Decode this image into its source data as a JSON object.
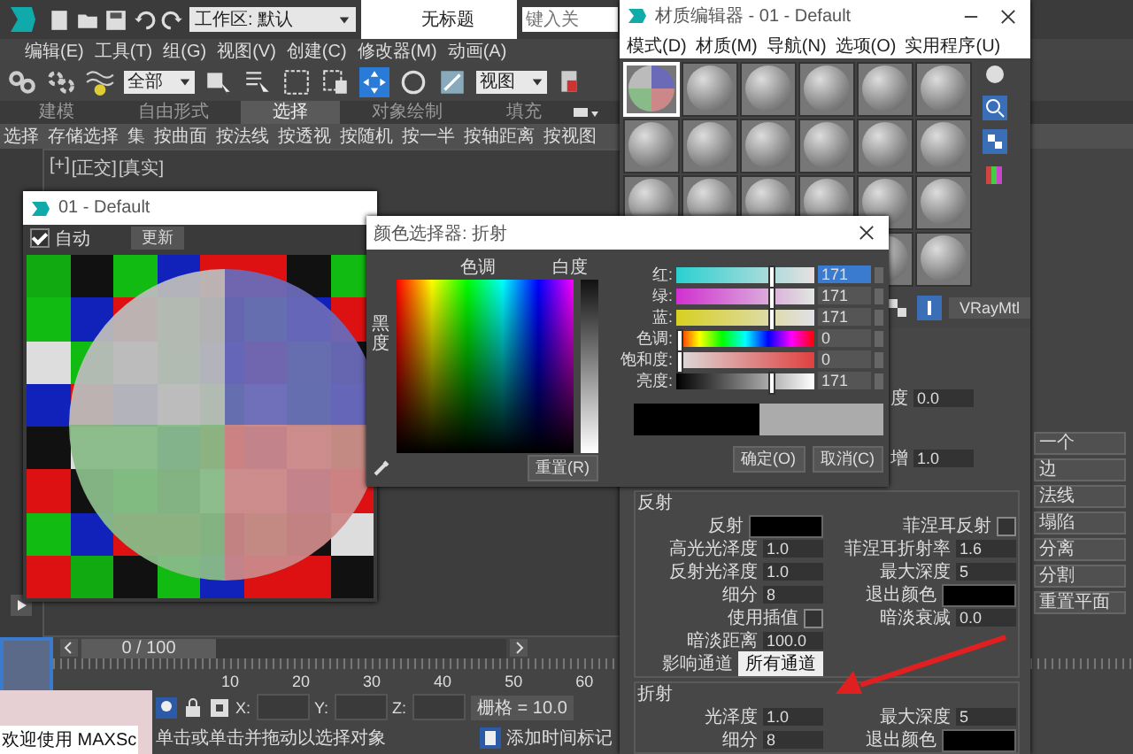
{
  "app": {
    "workspace": "工作区: 默认",
    "title": "无标题",
    "search_placeholder": "键入关"
  },
  "menu": [
    "编辑(E)",
    "工具(T)",
    "组(G)",
    "视图(V)",
    "创建(C)",
    "修改器(M)",
    "动画(A)"
  ],
  "toolbar": {
    "filter": "全部",
    "coord": "视图"
  },
  "ribbon_tabs": [
    {
      "label": "建模",
      "selected": false
    },
    {
      "label": "自由形式",
      "selected": false
    },
    {
      "label": "选择",
      "selected": true
    },
    {
      "label": "对象绘制",
      "selected": false
    },
    {
      "label": "填充",
      "selected": false
    }
  ],
  "ribbon_items": [
    "选择",
    "存储选择",
    "集",
    "按曲面",
    "按法线",
    "按透视",
    "按随机",
    "按一半",
    "按轴距离",
    "按视图"
  ],
  "viewport": {
    "labels": [
      "[+]",
      "[正交]",
      "[真实]"
    ]
  },
  "preview": {
    "title": "01 - Default",
    "auto": {
      "label": "自动",
      "checked": true
    },
    "update": "更新"
  },
  "color_picker": {
    "title": "颜色选择器: 折射",
    "hue_label": "色调",
    "white_label": "白度",
    "black_label": "黑度",
    "channels": [
      {
        "kind": "red",
        "label": "红:",
        "value": "171",
        "level": 0.67
      },
      {
        "kind": "green",
        "label": "绿:",
        "value": "171",
        "level": 0.67
      },
      {
        "kind": "blue",
        "label": "蓝:",
        "value": "171",
        "level": 0.67
      },
      {
        "kind": "hue",
        "label": "色调:",
        "value": "0",
        "level": 0
      },
      {
        "kind": "sat",
        "label": "饱和度:",
        "value": "0",
        "level": 0
      },
      {
        "kind": "val",
        "label": "亮度:",
        "value": "171",
        "level": 0.67
      }
    ],
    "reset": "重置(R)",
    "ok": "确定(O)",
    "cancel": "取消(C)"
  },
  "material_editor": {
    "title": "材质编辑器 - 01 - Default",
    "menu": [
      "模式(D)",
      "材质(M)",
      "导航(N)",
      "选项(O)",
      "实用程序(U)"
    ],
    "slots": [
      {
        "selected": true
      },
      {
        "selected": false
      },
      {
        "selected": false
      },
      {
        "selected": false
      },
      {
        "selected": false
      },
      {
        "selected": false
      },
      {
        "selected": false
      },
      {
        "selected": false
      },
      {
        "selected": false
      },
      {
        "selected": false
      },
      {
        "selected": false
      },
      {
        "selected": false
      },
      {
        "selected": false
      },
      {
        "selected": false
      },
      {
        "selected": false
      },
      {
        "selected": false
      },
      {
        "selected": false
      },
      {
        "selected": false
      },
      {
        "selected": false
      },
      {
        "selected": false
      }
    ],
    "type": "VRayMtl",
    "basic_params": [
      {
        "kind": "number",
        "label": "度",
        "value": "0.0"
      },
      {
        "kind": "number",
        "label": "增",
        "value": "1.0"
      }
    ],
    "reflection": {
      "title": "反射",
      "left": [
        {
          "kind": "color",
          "label": "反射"
        },
        {
          "kind": "number",
          "label": "高光光泽度",
          "value": "1.0"
        },
        {
          "kind": "number",
          "label": "反射光泽度",
          "value": "1.0"
        },
        {
          "kind": "number",
          "label": "细分",
          "value": "8"
        },
        {
          "kind": "check",
          "label": "使用插值",
          "checked": false
        },
        {
          "kind": "number",
          "label": "暗淡距离",
          "value": "100.0"
        },
        {
          "kind": "dropdown",
          "label": "影响通道",
          "value": "所有通道"
        }
      ],
      "right": [
        {
          "kind": "check",
          "label": "菲涅耳反射",
          "checked": false
        },
        {
          "kind": "number",
          "label": "菲涅耳折射率",
          "value": "1.6"
        },
        {
          "kind": "number",
          "label": "最大深度",
          "value": "5"
        },
        {
          "kind": "color",
          "label": "退出颜色"
        },
        {
          "kind": "number",
          "label": "暗淡衰减",
          "value": "0.0"
        }
      ]
    },
    "refraction": {
      "title": "折射",
      "left": [
        {
          "kind": "number",
          "label": "光泽度",
          "value": "1.0"
        },
        {
          "kind": "number",
          "label": "细分",
          "value": "8"
        }
      ],
      "right": [
        {
          "kind": "number",
          "label": "最大深度",
          "value": "5"
        },
        {
          "kind": "color",
          "label": "退出颜色"
        }
      ]
    }
  },
  "command_panel": {
    "buttons": [
      "一个",
      "边",
      "法线",
      "塌陷",
      "分离",
      "分割",
      "重置平面"
    ]
  },
  "timeline": {
    "frame": "0 / 100",
    "level": 0,
    "ticks": [
      "10",
      "20",
      "30",
      "40",
      "50",
      "60"
    ]
  },
  "status": {
    "welcome": "欢迎使用 MAXSc",
    "x_label": "X:",
    "y_label": "Y:",
    "z_label": "Z:",
    "grid": "栅格 = 10.0",
    "prompt": "单击或单击并拖动以选择对象",
    "add_tag": "添加时间标记"
  }
}
